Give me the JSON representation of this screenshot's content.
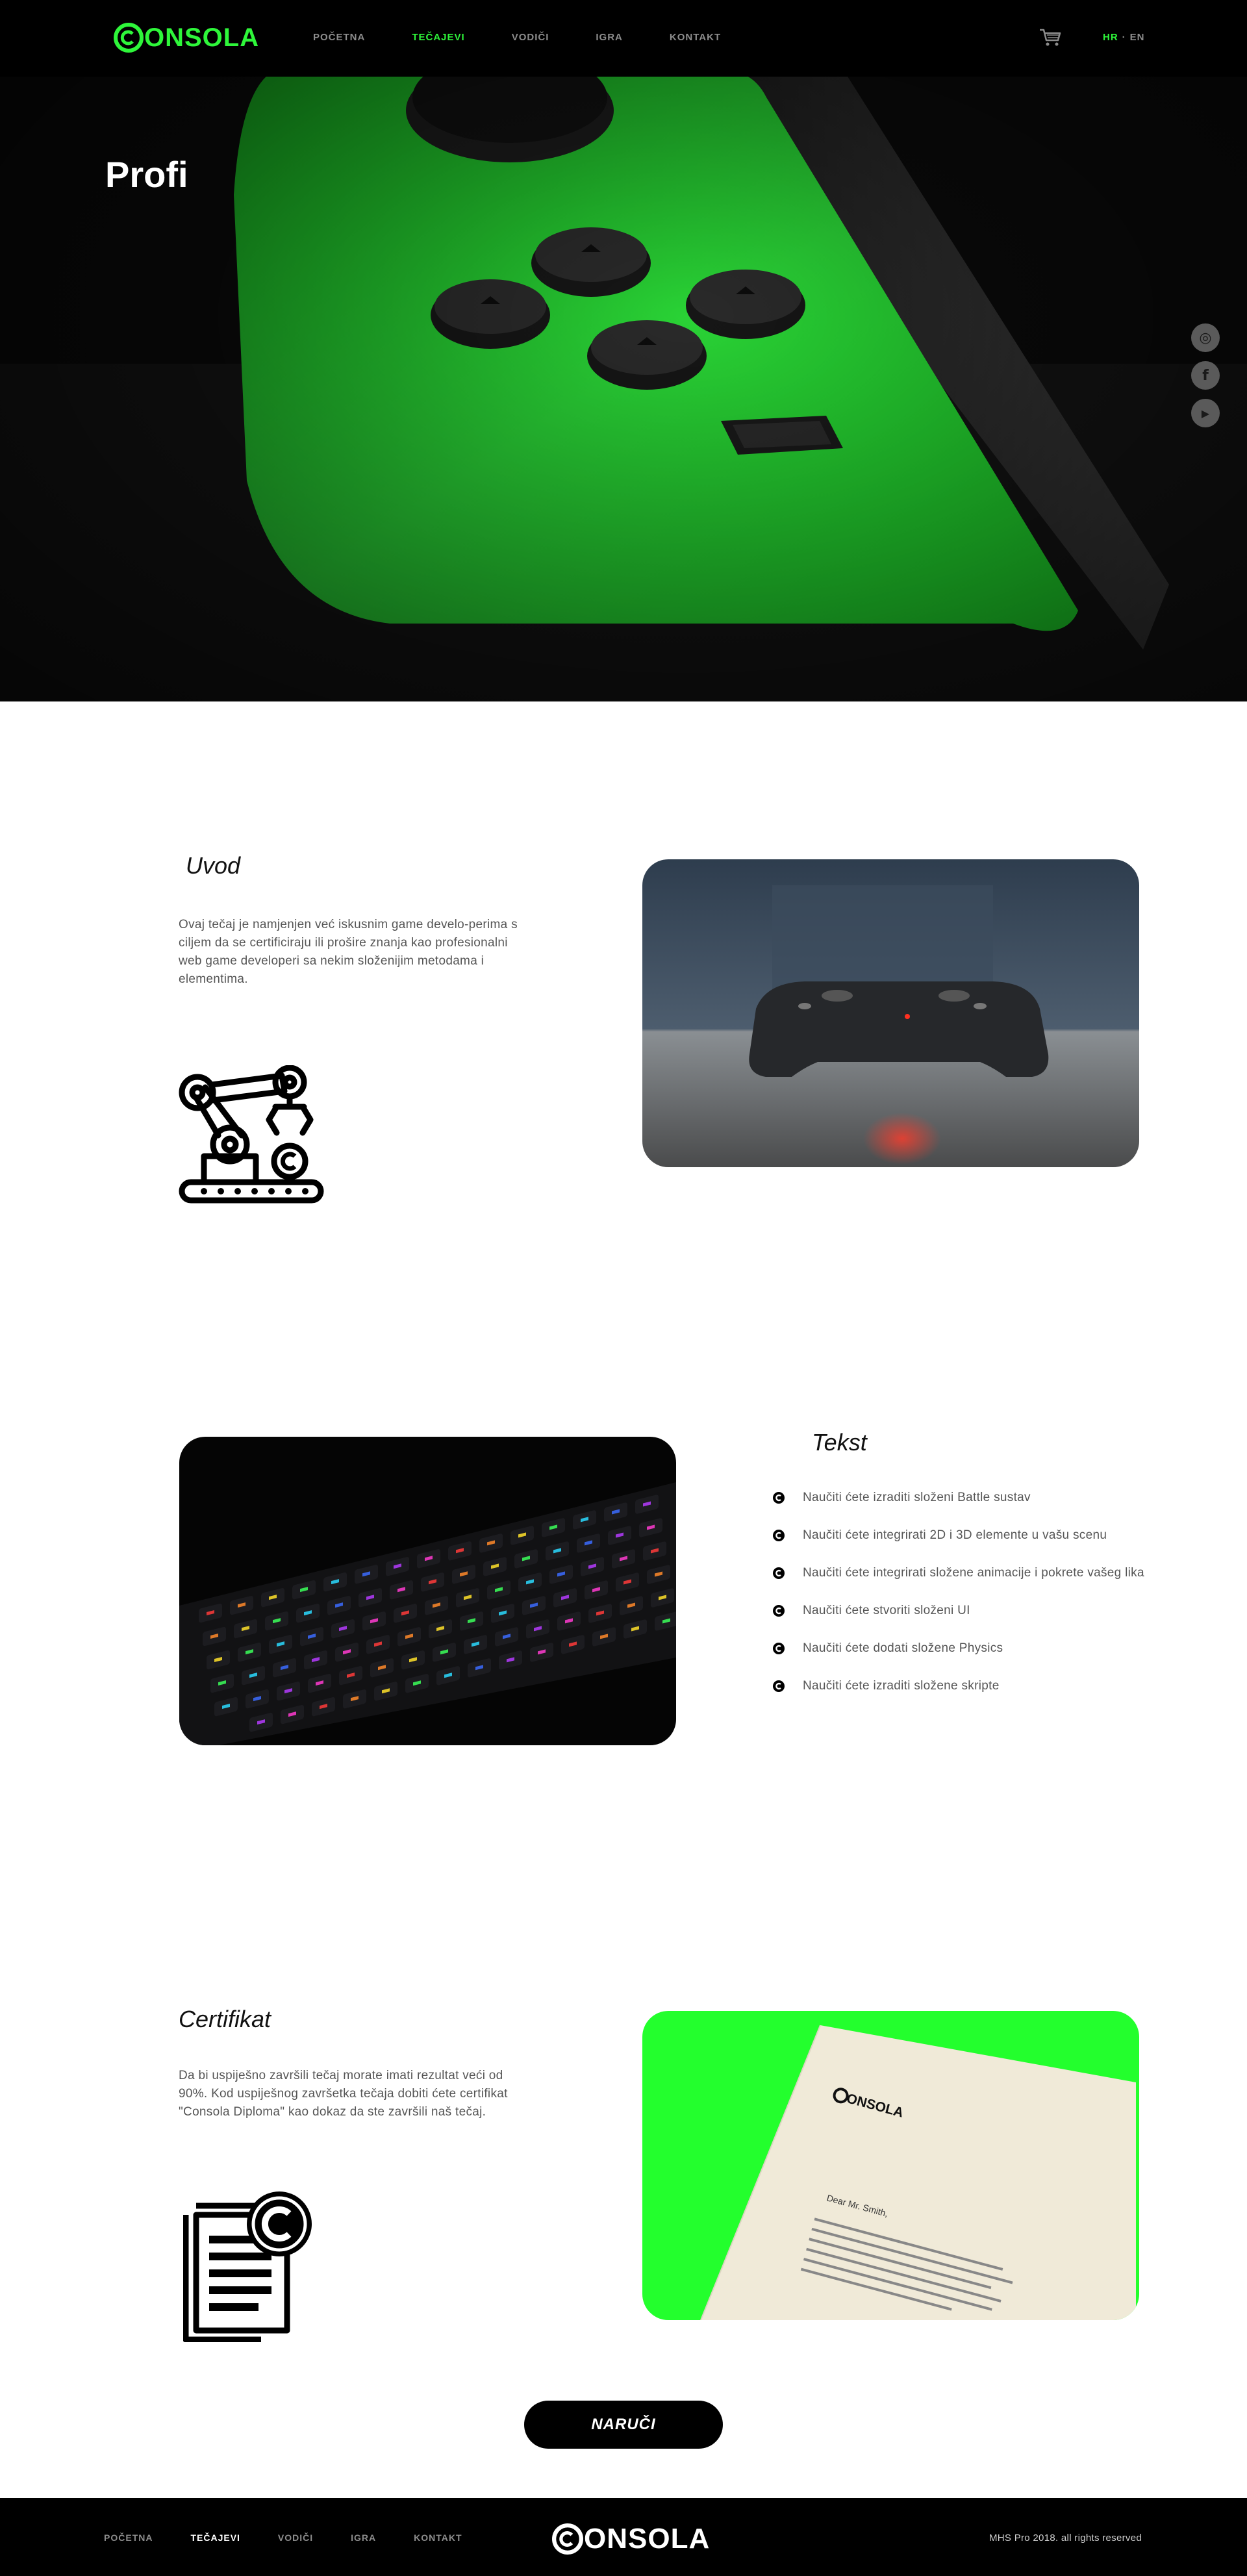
{
  "header": {
    "logo_text": "ONSOLA",
    "nav": [
      {
        "label": "POČETNA",
        "active": false
      },
      {
        "label": "TEČAJEVI",
        "active": true
      },
      {
        "label": "VODIČI",
        "active": false
      },
      {
        "label": "IGRA",
        "active": false
      },
      {
        "label": "KONTAKT",
        "active": false
      }
    ],
    "cart_icon": "shopping-cart-icon",
    "lang_active": "HR",
    "lang_sep": "·",
    "lang_other": "EN"
  },
  "hero": {
    "title": "Profi",
    "social_icons": [
      "instagram-icon",
      "facebook-icon",
      "youtube-icon"
    ],
    "social_glyphs": [
      "◎",
      "f",
      "▶"
    ]
  },
  "intro": {
    "heading": "Uvod",
    "text": "Ovaj tečaj je namjenjen već iskusnim game develo-perima s ciljem da se certificiraju ili prošire znanja kao profesionalni web game developeri sa nekim složenijim metodama i elementima.",
    "icon": "robotic-arm-icon",
    "photo": "game-controller-photo"
  },
  "features": {
    "heading": "Tekst",
    "photo": "backlit-keyboard-photo",
    "items": [
      "Naučiti ćete izraditi složeni Battle sustav",
      "Naučiti ćete integrirati 2D i 3D elemente u vašu scenu",
      "Naučiti ćete integrirati složene animacije i pokrete vašeg lika",
      "Naučiti ćete stvoriti složeni UI",
      "Naučiti ćete dodati složene Physics",
      "Naučiti ćete izraditi složene skripte"
    ]
  },
  "certificate": {
    "heading": "Certifikat",
    "text": "Da bi uspiješno završili tečaj morate imati rezultat veći od 90%. Kod uspiješnog završetka tečaja dobiti ćete certifikat \"Consola Diploma\" kao dokaz da ste završili naš tečaj.",
    "icon": "certificate-document-icon",
    "photo": "certificate-letter-photo",
    "letter_brand": "ONSOLA",
    "letter_greeting": "Dear Mr. Smith,"
  },
  "order_button": "NARUČI",
  "footer": {
    "nav": [
      {
        "label": "POČETNA",
        "active": false
      },
      {
        "label": "TEČAJEVI",
        "active": true
      },
      {
        "label": "VODIČI",
        "active": false
      },
      {
        "label": "IGRA",
        "active": false
      },
      {
        "label": "KONTAKT",
        "active": false
      }
    ],
    "logo_text": "ONSOLA",
    "copyright": "MHS Pro 2018. all rights reserved"
  },
  "colors": {
    "accent": "#2ef63a",
    "dark": "#000000",
    "text": "#555555"
  }
}
